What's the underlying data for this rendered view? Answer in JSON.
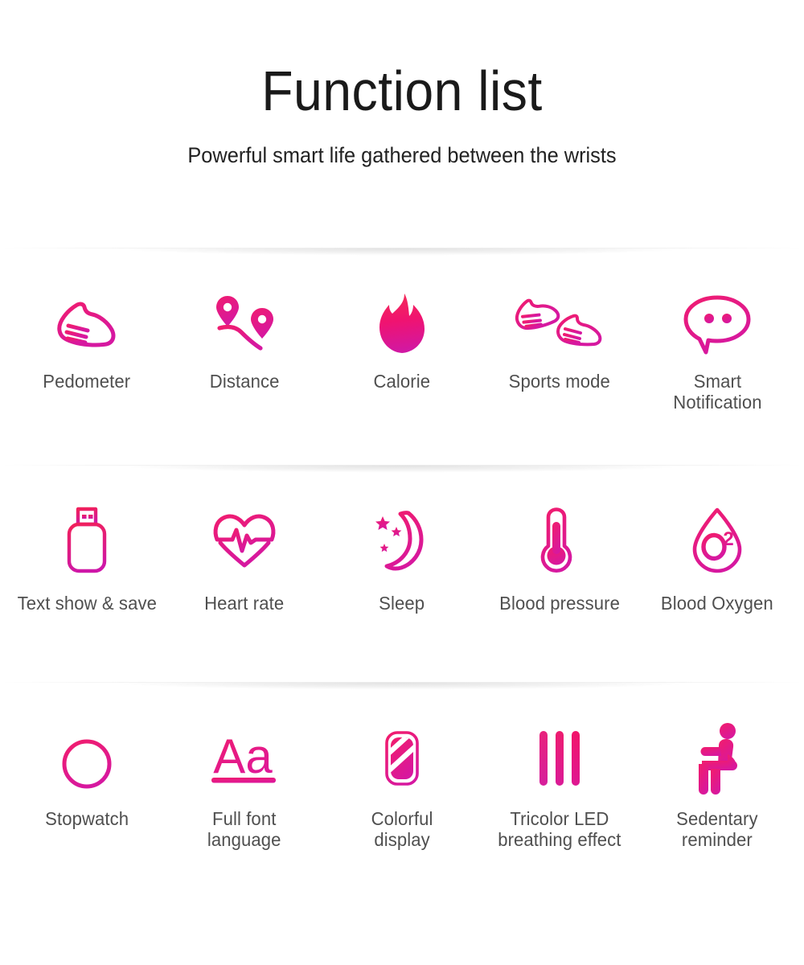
{
  "header": {
    "title": "Function list",
    "subtitle": "Powerful smart life gathered between the wrists"
  },
  "colors": {
    "accent_pink": "#EC1C79",
    "accent_pink_light": "#F2176B",
    "accent_magenta": "#D6199B",
    "label_text": "#4f4f4f",
    "title_text": "#1a1a1a",
    "background": "#ffffff",
    "divider": "rgba(0,0,0,0.09)"
  },
  "rows": [
    {
      "items": [
        {
          "label": "Pedometer",
          "icon": "running-shoe-icon"
        },
        {
          "label": "Distance",
          "icon": "route-map-pins-icon"
        },
        {
          "label": "Calorie",
          "icon": "flame-icon"
        },
        {
          "label": "Sports mode",
          "icon": "two-sneakers-icon"
        },
        {
          "label": "Smart\nNotification",
          "icon": "chat-bubble-icon"
        }
      ]
    },
    {
      "items": [
        {
          "label": "Text show & save",
          "icon": "usb-flash-drive-icon"
        },
        {
          "label": "Heart rate",
          "icon": "heart-pulse-icon"
        },
        {
          "label": "Sleep",
          "icon": "moon-stars-icon"
        },
        {
          "label": "Blood pressure",
          "icon": "thermometer-icon"
        },
        {
          "label": "Blood Oxygen",
          "icon": "droplet-o2-icon"
        }
      ]
    },
    {
      "items": [
        {
          "label": "Stopwatch",
          "icon": "stopwatch-icon"
        },
        {
          "label": "Full font\nlanguage",
          "icon": "typography-aa-icon"
        },
        {
          "label": "Colorful\ndisplay",
          "icon": "smart-band-icon"
        },
        {
          "label": "Tricolor LED\nbreathing effect",
          "icon": "three-bars-icon"
        },
        {
          "label": "Sedentary\nreminder",
          "icon": "seated-person-icon"
        }
      ]
    }
  ],
  "dividers": [
    {
      "name": "divider-1"
    },
    {
      "name": "divider-2"
    },
    {
      "name": "divider-3"
    }
  ]
}
